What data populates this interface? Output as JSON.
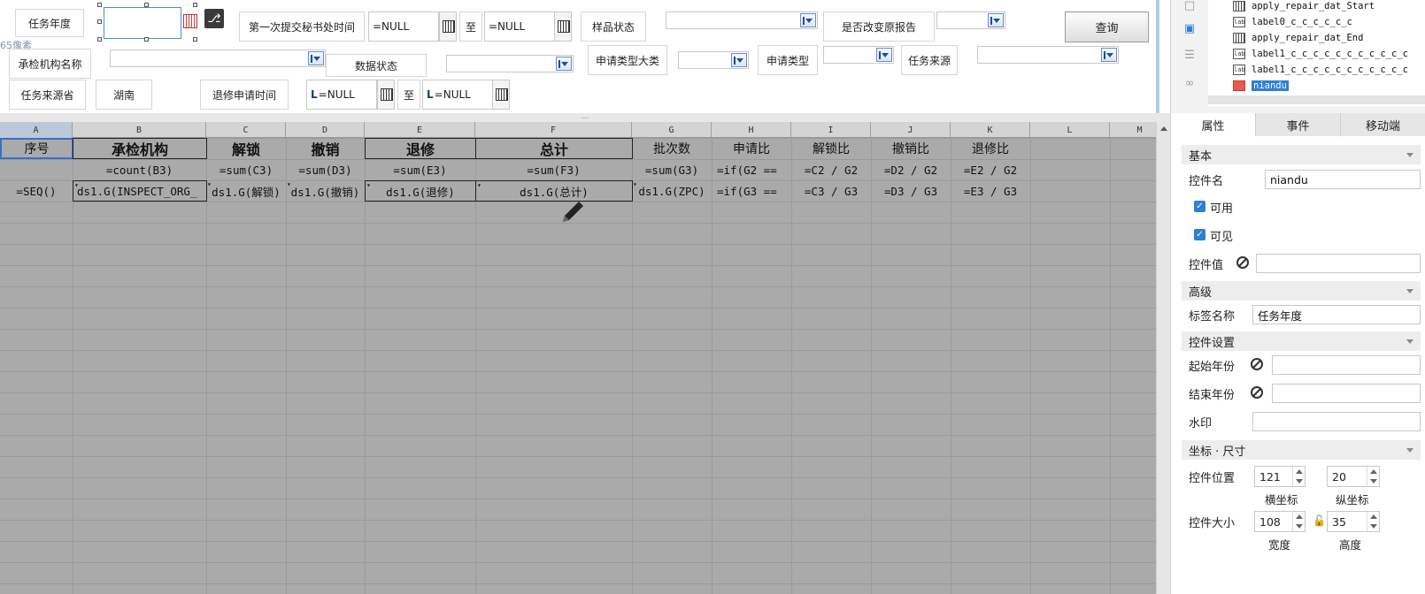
{
  "form": {
    "task_year_label": "任务年度",
    "px_note": "65像素",
    "first_submit_label": "第一次提交秘书处时间",
    "first_submit_start": "=NULL",
    "first_submit_to": "至",
    "first_submit_end": "=NULL",
    "sample_status_label": "样品状态",
    "change_report_label": "是否改变原报告",
    "query_button": "查询",
    "inspect_org_label": "承检机构名称",
    "data_status_label": "数据状态",
    "apply_type_major_label": "申请类型大类",
    "apply_type_label": "申请类型",
    "task_source_label": "任务来源",
    "task_source_province_label": "任务来源省",
    "task_source_province_value": "湖南",
    "repair_apply_time_label": "退修申请时间",
    "repair_start": "=NULL",
    "repair_to": "至",
    "repair_end": "=NULL",
    "lock_icon": "lock-icon",
    "calendar_icon": "calendar-icon"
  },
  "sheet": {
    "columns": [
      "A",
      "B",
      "C",
      "D",
      "E",
      "F",
      "G",
      "H",
      "I",
      "J",
      "K",
      "L",
      "M"
    ],
    "row1": [
      "序号",
      "承检机构",
      "解锁",
      "撤销",
      "退修",
      "总计",
      "批次数",
      "申请比",
      "解锁比",
      "撤销比",
      "退修比"
    ],
    "row2": [
      "",
      "=count(B3)",
      "=sum(C3)",
      "=sum(D3)",
      "=sum(E3)",
      "=sum(F3)",
      "=sum(G3)",
      "=if(G2 ==",
      "=C2 / G2",
      "=D2 / G2",
      "=E2 / G2"
    ],
    "row3": [
      "=SEQ()",
      "ds1.G(INSPECT_ORG_",
      "ds1.G(解锁)",
      "ds1.G(撤销)",
      "ds1.G(退修)",
      "ds1.G(总计)",
      "ds1.G(ZPC)",
      "=if(G3 ==",
      "=C3 / G3",
      "=D3 / G3",
      "=E3 / G3"
    ],
    "splitter": "...",
    "pencil_icon": "pencil-icon"
  },
  "panel": {
    "tree": [
      {
        "icon": "calendar",
        "label": "apply_repair_dat_Start"
      },
      {
        "icon": "label",
        "label": "label0_c_c_c_c_c_c"
      },
      {
        "icon": "calendar",
        "label": "apply_repair_dat_End"
      },
      {
        "icon": "label",
        "label": "label1_c_c_c_c_c_c_c_c_c_c_c"
      },
      {
        "icon": "label",
        "label": "label1_c_c_c_c_c_c_c_c_c_c_c"
      },
      {
        "icon": "date-red",
        "label": "niandu"
      }
    ],
    "tabs": [
      "属性",
      "事件",
      "移动端"
    ],
    "sections": {
      "basic": "基本",
      "advanced": "高级",
      "widget_settings": "控件设置",
      "coords": "坐标 · 尺寸"
    },
    "widget_name_label": "控件名",
    "widget_name_value": "niandu",
    "enabled_label": "可用",
    "visible_label": "可见",
    "widget_value_label": "控件值",
    "tag_name_label": "标签名称",
    "tag_name_value": "任务年度",
    "start_year_label": "起始年份",
    "end_year_label": "结束年份",
    "watermark_label": "水印",
    "position_label": "控件位置",
    "pos_x": "121",
    "pos_y": "20",
    "x_caption": "横坐标",
    "y_caption": "纵坐标",
    "size_label": "控件大小",
    "width": "108",
    "height": "35",
    "width_caption": "宽度",
    "height_caption": "高度",
    "checkmark": "✓"
  }
}
